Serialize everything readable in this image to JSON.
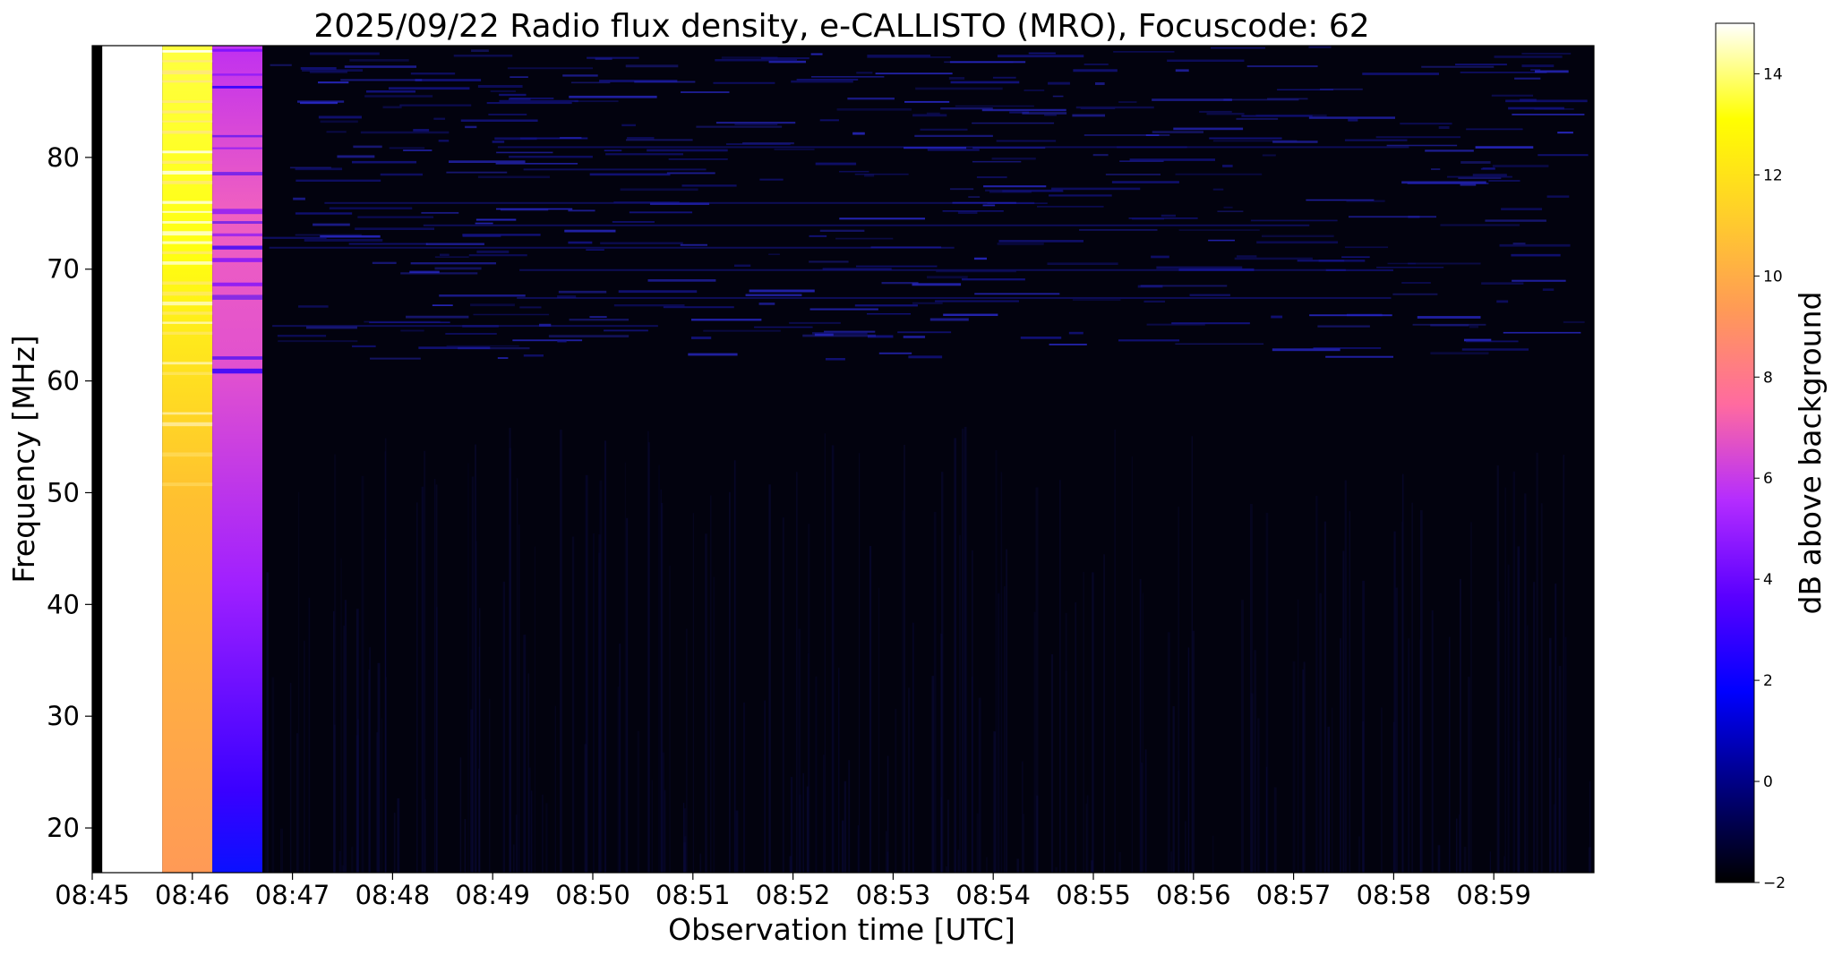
{
  "chart_data": {
    "type": "heatmap",
    "title": "2025/09/22  Radio flux density, e-CALLISTO (MRO), Focuscode: 62",
    "xlabel": "Observation time [UTC]",
    "ylabel": "Frequency [MHz]",
    "colorbar_label": "dB above background",
    "x_tick_labels": [
      "08:45",
      "08:46",
      "08:47",
      "08:48",
      "08:49",
      "08:50",
      "08:51",
      "08:52",
      "08:53",
      "08:54",
      "08:55",
      "08:56",
      "08:57",
      "08:58",
      "08:59"
    ],
    "x_range": [
      "08:45:00",
      "09:00:00"
    ],
    "y_ticks": [
      20,
      30,
      40,
      50,
      60,
      70,
      80
    ],
    "y_range": [
      16,
      90
    ],
    "colorbar_ticks": [
      -2,
      0,
      2,
      4,
      6,
      8,
      10,
      12,
      14
    ],
    "colorbar_range": [
      -2,
      15
    ],
    "colormap": "gnuplot2",
    "colormap_stops": [
      "#000000",
      "#00007f",
      "#0000ff",
      "#5a00ff",
      "#b42cff",
      "#ff6aa0",
      "#ff9a56",
      "#ffcf2a",
      "#ffff00",
      "#ffffff"
    ],
    "bands": [
      {
        "name": "calibration-gap",
        "start": "08:45:00",
        "end": "08:45:06",
        "db_low": -2,
        "db_high": -2
      },
      {
        "name": "calibration-hot",
        "start": "08:45:06",
        "end": "08:45:42",
        "db_low": 15,
        "db_high": 15
      },
      {
        "name": "calibration-warm",
        "start": "08:45:42",
        "end": "08:46:12",
        "db_low": 11,
        "db_high": 14.5
      },
      {
        "name": "calibration-cool",
        "start": "08:46:12",
        "end": "08:46:42",
        "db_low": 2,
        "db_high": 8
      },
      {
        "name": "background",
        "start": "08:46:42",
        "end": "09:00:00",
        "db_low": -2,
        "db_high": 0.5
      }
    ]
  }
}
